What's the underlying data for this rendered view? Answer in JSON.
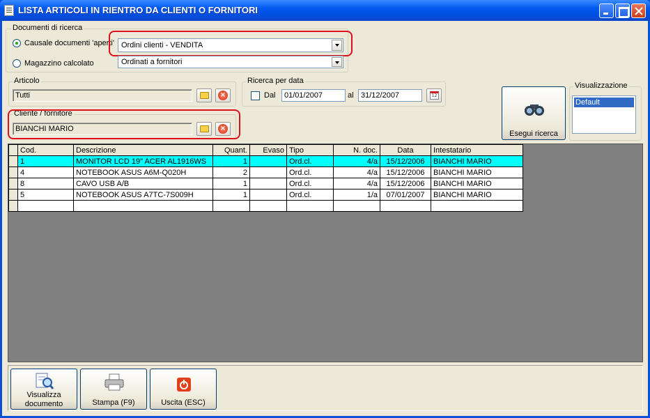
{
  "window": {
    "title": "LISTA ARTICOLI IN RIENTRO DA CLIENTI O FORNITORI"
  },
  "documenti": {
    "legend": "Documenti di ricerca",
    "opt_causale_label": "Causale documenti 'aperti'",
    "opt_causale_selected": true,
    "causale_value": "Ordini clienti - VENDITA",
    "opt_magazzino_label": "Magazzino calcolato",
    "magazzino_value": "Ordinati a fornitori"
  },
  "articolo": {
    "legend": "Articolo",
    "value": "Tutti"
  },
  "cliente": {
    "legend": "Cliente / fornitore",
    "value": "BIANCHI MARIO"
  },
  "ricerca_data": {
    "legend": "Ricerca per data",
    "dal_label": "Dal",
    "dal_value": "01/01/2007",
    "al_label": "al",
    "al_value": "31/12/2007",
    "calendar_icon_text": "12"
  },
  "esegui": {
    "label": "Esegui ricerca"
  },
  "visualizzazione": {
    "legend": "Visualizzazione",
    "selected": "Default"
  },
  "grid": {
    "columns": [
      "Cod.",
      "Descrizione",
      "Quant.",
      "Evaso",
      "Tipo",
      "N. doc.",
      "Data",
      "Intestatario"
    ],
    "rows": [
      {
        "cod": "1",
        "descrizione": "MONITOR LCD 19\" ACER AL1916WS",
        "quant": "1",
        "evaso": "",
        "tipo": "Ord.cl.",
        "ndoc": "4/a",
        "data": "15/12/2006",
        "intestatario": "BIANCHI MARIO"
      },
      {
        "cod": "4",
        "descrizione": "NOTEBOOK ASUS A6M-Q020H",
        "quant": "2",
        "evaso": "",
        "tipo": "Ord.cl.",
        "ndoc": "4/a",
        "data": "15/12/2006",
        "intestatario": "BIANCHI MARIO"
      },
      {
        "cod": "8",
        "descrizione": "CAVO USB A/B",
        "quant": "1",
        "evaso": "",
        "tipo": "Ord.cl.",
        "ndoc": "4/a",
        "data": "15/12/2006",
        "intestatario": "BIANCHI MARIO"
      },
      {
        "cod": "5",
        "descrizione": "NOTEBOOK ASUS A7TC-7S009H",
        "quant": "1",
        "evaso": "",
        "tipo": "Ord.cl.",
        "ndoc": "1/a",
        "data": "07/01/2007",
        "intestatario": "BIANCHI MARIO"
      }
    ]
  },
  "toolbar": {
    "visualizza_line1": "Visualizza",
    "visualizza_line2": "documento",
    "stampa": "Stampa (F9)",
    "uscita": "Uscita (ESC)"
  },
  "colors": {
    "selected_row": "#00ffff",
    "highlight": "#e0101a",
    "grid_bg": "#808080"
  }
}
